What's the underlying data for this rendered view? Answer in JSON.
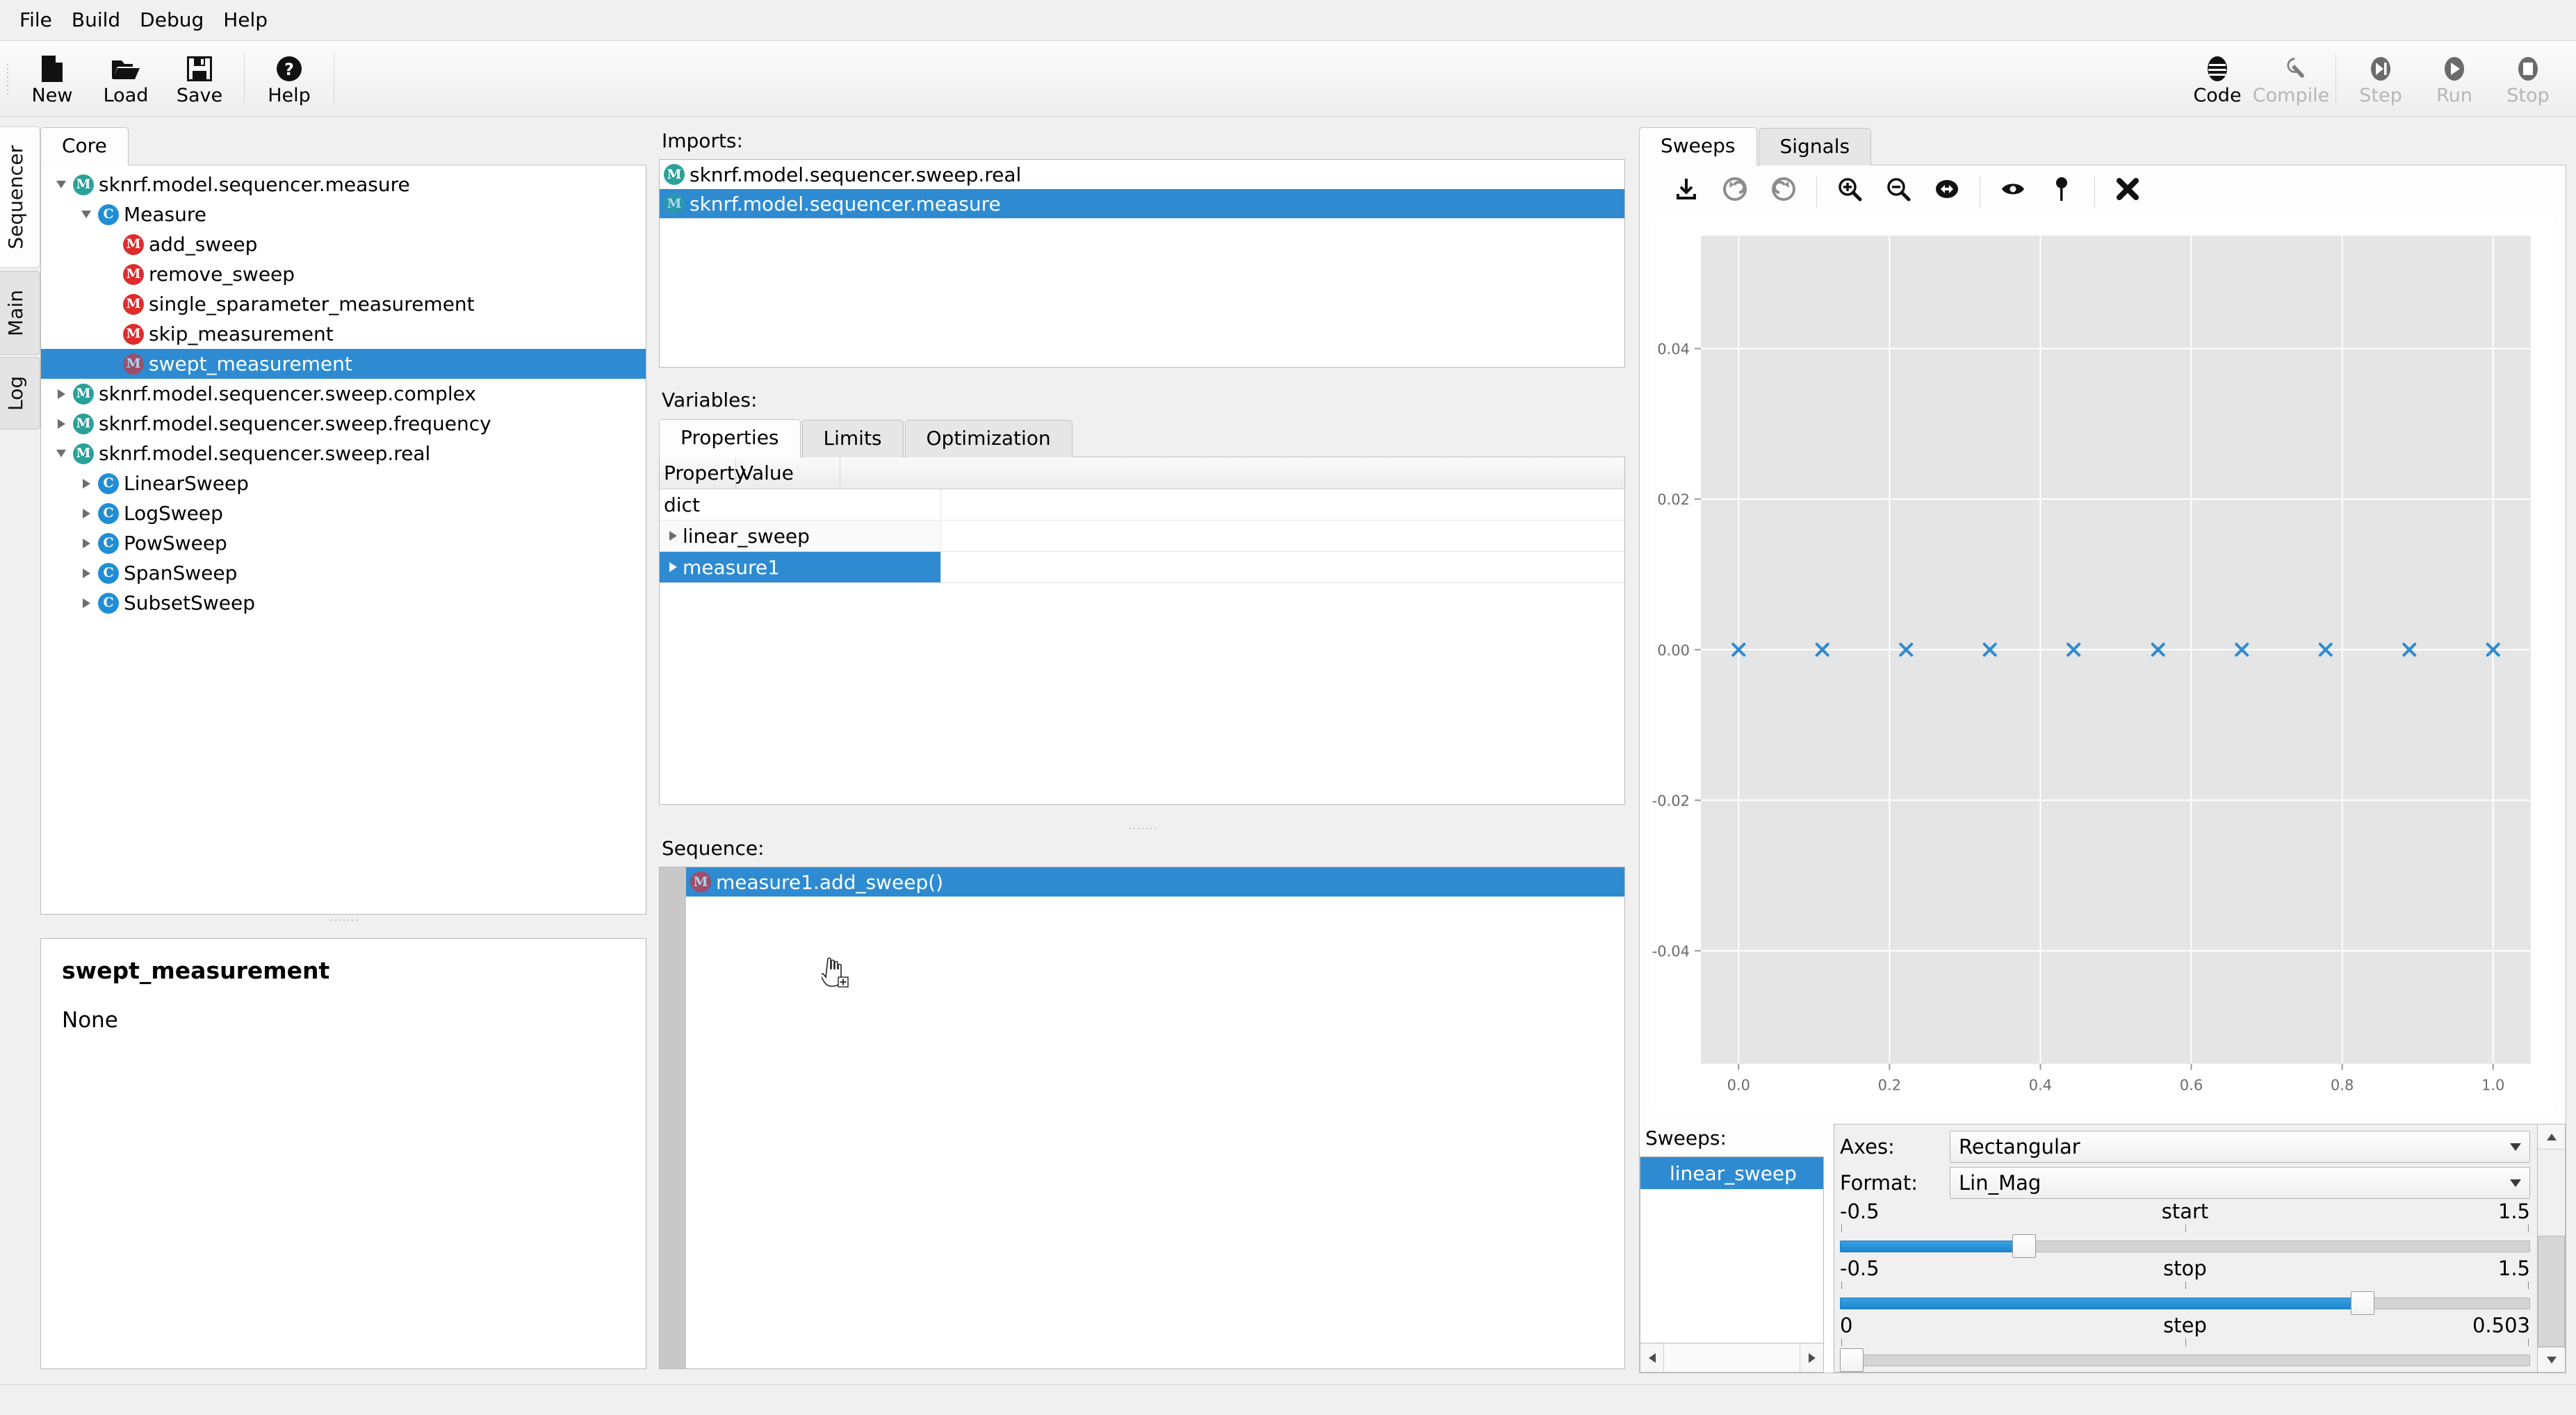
{
  "menubar": {
    "items": [
      "File",
      "Build",
      "Debug",
      "Help"
    ]
  },
  "toolbar": {
    "left": [
      {
        "label": "New",
        "icon": "new-file-icon",
        "enabled": true
      },
      {
        "label": "Load",
        "icon": "open-folder-icon",
        "enabled": true
      },
      {
        "label": "Save",
        "icon": "floppy-disk-icon",
        "enabled": true
      },
      {
        "label": "Help",
        "icon": "question-circle-icon",
        "enabled": true
      }
    ],
    "right": [
      {
        "label": "Code",
        "icon": "code-lines-icon",
        "enabled": true
      },
      {
        "label": "Compile",
        "icon": "wrench-icon",
        "enabled": false
      },
      {
        "label": "Step",
        "icon": "step-icon",
        "enabled": false
      },
      {
        "label": "Run",
        "icon": "play-icon",
        "enabled": false
      },
      {
        "label": "Stop",
        "icon": "stop-square-icon",
        "enabled": false
      }
    ]
  },
  "vertical_tabs": [
    {
      "label": "Sequencer",
      "active": true
    },
    {
      "label": "Main",
      "active": false
    },
    {
      "label": "Log",
      "active": false
    }
  ],
  "left_panel": {
    "tabs": [
      {
        "label": "Core",
        "active": true
      }
    ],
    "tree": [
      {
        "label": "sknrf.model.sequencer.measure",
        "depth": 0,
        "kind": "module",
        "twist": "down",
        "selected": false
      },
      {
        "label": "Measure",
        "depth": 1,
        "kind": "class",
        "twist": "down",
        "selected": false
      },
      {
        "label": "add_sweep",
        "depth": 2,
        "kind": "method",
        "twist": "none",
        "selected": false
      },
      {
        "label": "remove_sweep",
        "depth": 2,
        "kind": "method",
        "twist": "none",
        "selected": false
      },
      {
        "label": "single_sparameter_measurement",
        "depth": 2,
        "kind": "method",
        "twist": "none",
        "selected": false
      },
      {
        "label": "skip_measurement",
        "depth": 2,
        "kind": "method",
        "twist": "none",
        "selected": false
      },
      {
        "label": "swept_measurement",
        "depth": 2,
        "kind": "method",
        "twist": "none",
        "selected": true
      },
      {
        "label": "sknrf.model.sequencer.sweep.complex",
        "depth": 0,
        "kind": "module",
        "twist": "right",
        "selected": false
      },
      {
        "label": "sknrf.model.sequencer.sweep.frequency",
        "depth": 0,
        "kind": "module",
        "twist": "right",
        "selected": false
      },
      {
        "label": "sknrf.model.sequencer.sweep.real",
        "depth": 0,
        "kind": "module",
        "twist": "down",
        "selected": false
      },
      {
        "label": "LinearSweep",
        "depth": 1,
        "kind": "class",
        "twist": "right",
        "selected": false
      },
      {
        "label": "LogSweep",
        "depth": 1,
        "kind": "class",
        "twist": "right",
        "selected": false
      },
      {
        "label": "PowSweep",
        "depth": 1,
        "kind": "class",
        "twist": "right",
        "selected": false
      },
      {
        "label": "SpanSweep",
        "depth": 1,
        "kind": "class",
        "twist": "right",
        "selected": false
      },
      {
        "label": "SubsetSweep",
        "depth": 1,
        "kind": "class",
        "twist": "right",
        "selected": false
      }
    ],
    "doc": {
      "title": "swept_measurement",
      "body": "None"
    }
  },
  "center_panel": {
    "imports_label": "Imports:",
    "imports": [
      {
        "label": "sknrf.model.sequencer.sweep.real",
        "kind": "module",
        "selected": false
      },
      {
        "label": "sknrf.model.sequencer.measure",
        "kind": "module",
        "selected": true
      }
    ],
    "variables_label": "Variables:",
    "variable_tabs": [
      {
        "label": "Properties",
        "active": true
      },
      {
        "label": "Limits",
        "active": false
      },
      {
        "label": "Optimization",
        "active": false
      }
    ],
    "property_columns": [
      "Property",
      "Value"
    ],
    "property_rows": [
      {
        "name": "dict",
        "value": "",
        "indent": 0,
        "twist": "none",
        "selected": false
      },
      {
        "name": "linear_sweep",
        "value": "",
        "indent": 1,
        "twist": "right",
        "selected": false
      },
      {
        "name": "measure1",
        "value": "",
        "indent": 1,
        "twist": "right",
        "selected": true
      }
    ],
    "sequence_label": "Sequence:",
    "sequence": [
      {
        "label": "measure1.add_sweep()",
        "kind": "method",
        "selected": true
      }
    ]
  },
  "right_panel": {
    "tabs": [
      {
        "label": "Sweeps",
        "active": true
      },
      {
        "label": "Signals",
        "active": false
      }
    ],
    "plot_toolbar": [
      {
        "icon": "save-download-icon",
        "enabled": true
      },
      {
        "icon": "undo-icon",
        "enabled": false
      },
      {
        "icon": "redo-icon",
        "enabled": false
      },
      {
        "sep": true
      },
      {
        "icon": "zoom-in-icon",
        "enabled": true
      },
      {
        "icon": "zoom-out-icon",
        "enabled": true
      },
      {
        "icon": "pan-horizontal-icon",
        "enabled": true
      },
      {
        "sep": true
      },
      {
        "icon": "eye-visibility-icon",
        "enabled": true
      },
      {
        "icon": "marker-pin-icon",
        "enabled": true
      },
      {
        "sep": true
      },
      {
        "icon": "close-x-icon",
        "enabled": true
      }
    ],
    "sweeps_label": "Sweeps:",
    "sweeps_list": [
      {
        "label": "linear_sweep",
        "color": "#2e8bd1",
        "selected": true
      }
    ],
    "form": {
      "axes_label": "Axes:",
      "axes_value": "Rectangular",
      "format_label": "Format:",
      "format_value": "Lin_Mag",
      "sliders": [
        {
          "name": "start",
          "min": "-0.5",
          "max": "1.5",
          "value_frac": 0.25
        },
        {
          "name": "stop",
          "min": "-0.5",
          "max": "1.5",
          "value_frac": 0.74
        },
        {
          "name": "step",
          "min": "0",
          "max": "0.503",
          "value_frac": 0.0
        }
      ]
    }
  },
  "chart_data": {
    "type": "scatter",
    "title": "",
    "xlabel": "",
    "ylabel": "",
    "xlim": [
      -0.05,
      1.05
    ],
    "ylim": [
      -0.055,
      0.055
    ],
    "xticks": [
      "0.0",
      "0.2",
      "0.4",
      "0.6",
      "0.8",
      "1.0"
    ],
    "xtick_values": [
      0.0,
      0.2,
      0.4,
      0.6,
      0.8,
      1.0
    ],
    "yticks": [
      "0.04",
      "0.02",
      "0.00",
      "-0.02",
      "-0.04"
    ],
    "ytick_values": [
      0.04,
      0.02,
      0.0,
      -0.02,
      -0.04
    ],
    "grid": true,
    "legend": "none",
    "plot_bg": "#e5e5e5",
    "series": [
      {
        "name": "linear_sweep",
        "marker": "x",
        "color": "#2e8bd1",
        "x": [
          0.0,
          0.111,
          0.222,
          0.333,
          0.444,
          0.556,
          0.667,
          0.778,
          0.889,
          1.0
        ],
        "y": [
          0,
          0,
          0,
          0,
          0,
          0,
          0,
          0,
          0,
          0
        ]
      }
    ]
  }
}
